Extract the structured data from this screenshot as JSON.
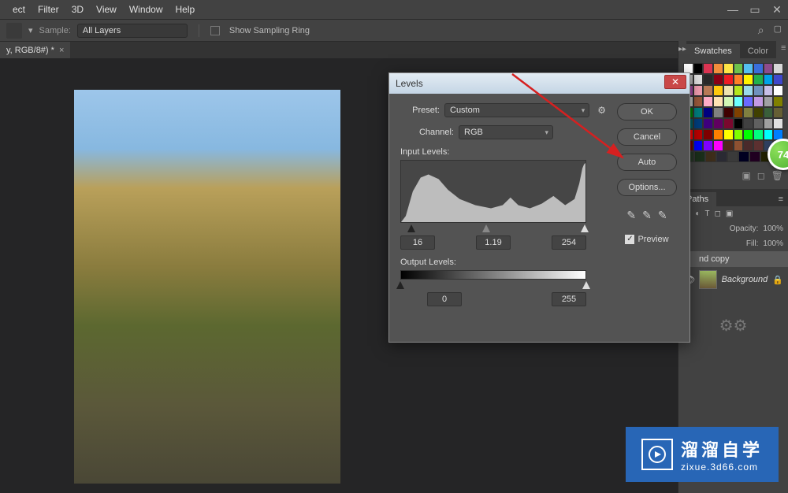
{
  "menu": {
    "items": [
      "ect",
      "Filter",
      "3D",
      "View",
      "Window",
      "Help"
    ]
  },
  "options_bar": {
    "sample_label": "Sample:",
    "sample_value": "All Layers",
    "show_sampling_ring": "Show Sampling Ring"
  },
  "document_tab": {
    "name": "y, RGB/8#) *"
  },
  "right_panel": {
    "tab_swatches": "Swatches",
    "tab_color": "Color",
    "tab_paths": "Paths"
  },
  "swatch_colors": [
    [
      "#ffffff",
      "#000000",
      "#db3452",
      "#f28e3c",
      "#fee546",
      "#6dc24b",
      "#55bff0",
      "#396edb",
      "#8e4b8c",
      "#d7d7d7"
    ],
    [
      "#b0b0b0",
      "#e2e2e2",
      "#292929",
      "#880015",
      "#ed1c24",
      "#ff7f27",
      "#fff200",
      "#22b14c",
      "#00a2e8",
      "#3f48cc"
    ],
    [
      "#a349a4",
      "#f6a1b4",
      "#b97a57",
      "#ffc90e",
      "#efe4b0",
      "#b5e61d",
      "#99d9ea",
      "#7092be",
      "#c8bfe7",
      "#ffffff"
    ],
    [
      "#c3c3c3",
      "#9c5a3c",
      "#ffaec8",
      "#ffe2b4",
      "#d2f7b5",
      "#6bffff",
      "#6a6aff",
      "#c39ae4",
      "#a0a0a4",
      "#808000"
    ],
    [
      "#008000",
      "#008080",
      "#000080",
      "#808080",
      "#400000",
      "#804000",
      "#808040",
      "#404000",
      "#3a5f3a",
      "#665f34"
    ],
    [
      "#005f5f",
      "#003f7f",
      "#3f007f",
      "#600060",
      "#7a082e",
      "#000000",
      "#404040",
      "#606060",
      "#a0a0a0",
      "#e0e0e0"
    ],
    [
      "#ff0000",
      "#bf0000",
      "#7f0000",
      "#ff7f00",
      "#ffff00",
      "#7fff00",
      "#00ff00",
      "#00ff7f",
      "#00ffff",
      "#007fff"
    ],
    [
      "#6e0000",
      "#0000ff",
      "#7f00ff",
      "#ff00ff",
      "#4f2a1a",
      "#8e5131",
      "#4a2a2a",
      "#5c3030",
      "#2f3f5f",
      "#4f4f7f"
    ],
    [
      "#263626",
      "#1a2f1a",
      "#3d2d1a",
      "#2a2a33",
      "#3a3a3a",
      "#000020",
      "#200020",
      "#202000"
    ]
  ],
  "layers": {
    "opacity_label": "Opacity:",
    "opacity_value": "100%",
    "fill_label": "Fill:",
    "fill_value": "100%",
    "layers_list": [
      {
        "name": "nd copy",
        "visible": false,
        "locked": false,
        "selected": true
      },
      {
        "name": "Background",
        "visible": true,
        "locked": true,
        "selected": false
      }
    ]
  },
  "levels_dialog": {
    "title": "Levels",
    "preset_label": "Preset:",
    "preset_value": "Custom",
    "channel_label": "Channel:",
    "channel_value": "RGB",
    "input_label": "Input Levels:",
    "output_label": "Output Levels:",
    "input_black": "16",
    "input_gamma": "1.19",
    "input_white": "254",
    "output_black": "0",
    "output_white": "255",
    "btn_ok": "OK",
    "btn_cancel": "Cancel",
    "btn_auto": "Auto",
    "btn_options": "Options...",
    "preview_label": "Preview"
  },
  "watermark": {
    "text": "溜溜自学",
    "url": "zixue.3d66.com"
  },
  "badge": {
    "value": "74"
  }
}
